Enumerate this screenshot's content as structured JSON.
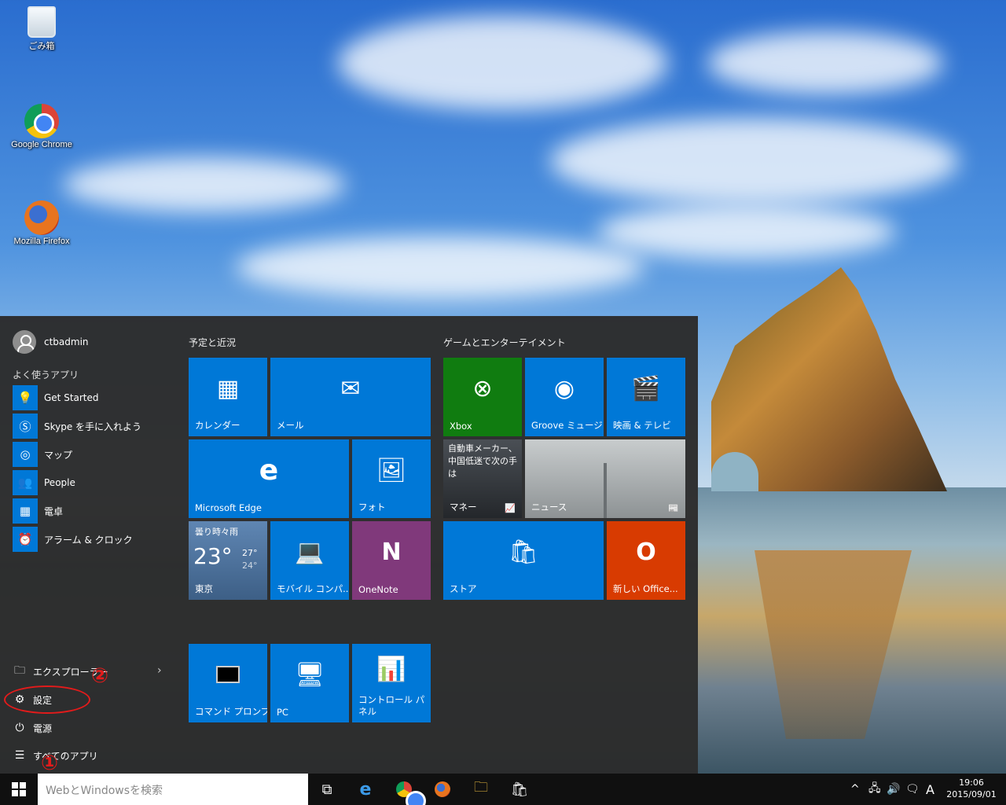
{
  "desktop": {
    "icons": [
      {
        "label": "ごみ箱",
        "icon": "recycle-bin-icon"
      },
      {
        "label": "Google Chrome",
        "icon": "chrome-icon"
      },
      {
        "label": "Mozilla Firefox",
        "icon": "firefox-icon"
      }
    ]
  },
  "start_menu": {
    "user": "ctbadmin",
    "most_used_header": "よく使うアプリ",
    "apps": [
      {
        "label": "Get Started",
        "icon": "lightbulb-icon"
      },
      {
        "label": "Skype を手に入れよう",
        "icon": "skype-icon"
      },
      {
        "label": "マップ",
        "icon": "maps-icon"
      },
      {
        "label": "People",
        "icon": "people-icon"
      },
      {
        "label": "電卓",
        "icon": "calculator-icon"
      },
      {
        "label": "アラーム & クロック",
        "icon": "alarm-clock-icon"
      }
    ],
    "system": {
      "explorer": "エクスプローラー",
      "settings": "設定",
      "power": "電源",
      "all_apps": "すべてのアプリ"
    },
    "groups": {
      "schedule": "予定と近況",
      "games": "ゲームとエンターテイメント"
    },
    "tiles": {
      "calendar": "カレンダー",
      "mail": "メール",
      "edge": "Microsoft Edge",
      "photos": "フォト",
      "weather_condition": "曇り時々雨",
      "weather_temp": "23°",
      "weather_high": "27°",
      "weather_low": "24°",
      "weather_city": "東京",
      "mobile": "モバイル コンパ...",
      "onenote": "OneNote",
      "xbox": "Xbox",
      "groove": "Groove ミュージ...",
      "movies": "映画 & テレビ",
      "money_headline": "自動車メーカー、中国低迷で次の手は",
      "money": "マネー",
      "news": "ニュース",
      "store": "ストア",
      "office": "新しい Office...",
      "cmd": "コマンド プロンプト",
      "pc": "PC",
      "control_panel": "コントロール パネル"
    }
  },
  "annotations": {
    "step1": "①",
    "step2": "②",
    "color": "#e21b1b"
  },
  "taskbar": {
    "search_placeholder": "WebとWindowsを検索",
    "ime": "A",
    "time": "19:06",
    "date": "2015/09/01"
  }
}
